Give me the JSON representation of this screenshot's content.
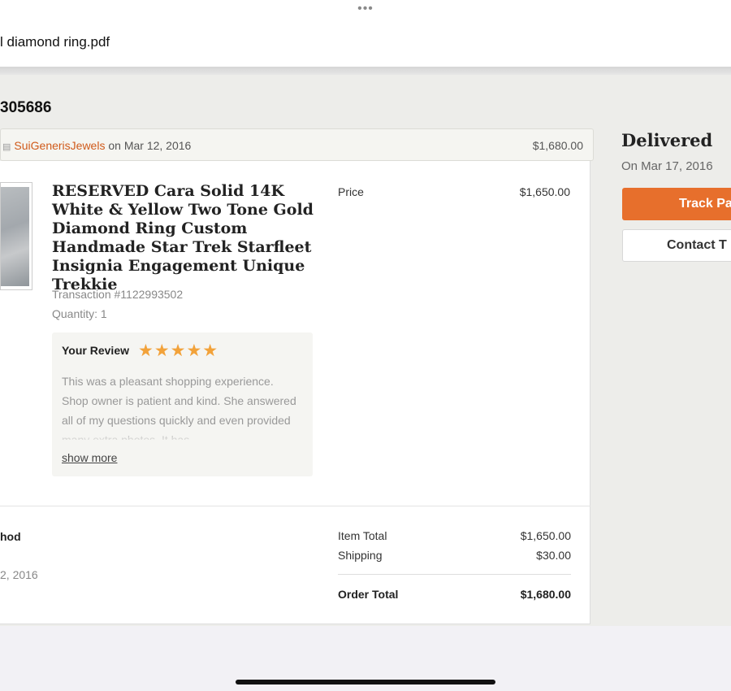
{
  "viewer": {
    "menu_dots": "•••",
    "doc_title": "l diamond ring.pdf"
  },
  "order": {
    "number_fragment": "305686",
    "shop_icon": "shop-icon",
    "shop_name": "SuiGenerisJewels",
    "shop_date_text": "on Mar 12, 2016",
    "shop_total": "$1,680.00"
  },
  "item": {
    "title": "RESERVED Cara Solid 14K White & Yellow Two Tone Gold Diamond Ring Custom Handmade Star Trek Starfleet Insignia Engagement Unique Trekkie",
    "transaction": "Transaction #1122993502",
    "quantity": "Quantity: 1",
    "price_label": "Price",
    "price_value": "$1,650.00"
  },
  "review": {
    "heading": "Your Review",
    "stars": "★★★★★",
    "rating": 5,
    "text": "This was a pleasant shopping experience. Shop owner is patient and kind. She answered all of my questions quickly and even provided many extra photos. It has",
    "show_more": "show more"
  },
  "payment": {
    "label_fragment": "hod",
    "date_fragment": "2, 2016"
  },
  "summary": {
    "item_total_label": "Item Total",
    "item_total_value": "$1,650.00",
    "shipping_label": "Shipping",
    "shipping_value": "$30.00",
    "order_total_label": "Order Total",
    "order_total_value": "$1,680.00"
  },
  "status": {
    "title": "Delivered",
    "date": "On Mar 17, 2016",
    "track_button": "Track Pa",
    "contact_button": "Contact T"
  },
  "colors": {
    "accent": "#e76f2c",
    "shop_link": "#d05a1a",
    "stars": "#f2a23a"
  }
}
